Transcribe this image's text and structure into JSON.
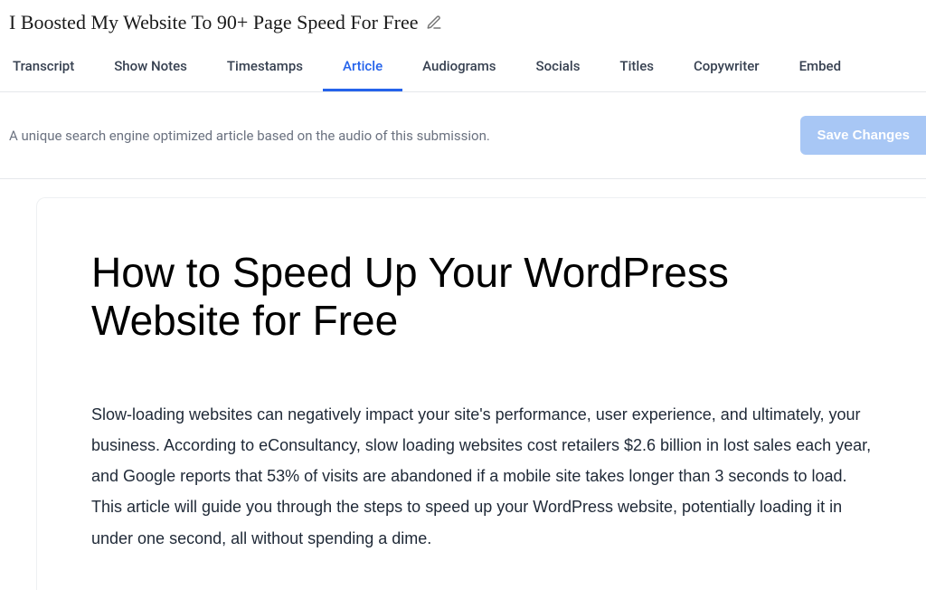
{
  "header": {
    "title": "I Boosted My Website To 90+ Page Speed For Free"
  },
  "tabs": {
    "items": [
      {
        "label": "Transcript"
      },
      {
        "label": "Show Notes"
      },
      {
        "label": "Timestamps"
      },
      {
        "label": "Article"
      },
      {
        "label": "Audiograms"
      },
      {
        "label": "Socials"
      },
      {
        "label": "Titles"
      },
      {
        "label": "Copywriter"
      },
      {
        "label": "Embed"
      }
    ],
    "activeIndex": 3
  },
  "subheader": {
    "description": "A unique search engine optimized article based on the audio of this submission.",
    "save_label": "Save Changes"
  },
  "article": {
    "title": "How to Speed Up Your WordPress Website for Free",
    "body": "Slow-loading websites can negatively impact your site's performance, user experience, and ultimately, your business. According to eConsultancy, slow loading websites cost retailers $2.6 billion in lost sales each year, and Google reports that 53% of visits are abandoned if a mobile site takes longer than 3 seconds to load. This article will guide you through the steps to speed up your WordPress website, potentially loading it in under one second, all without spending a dime."
  }
}
